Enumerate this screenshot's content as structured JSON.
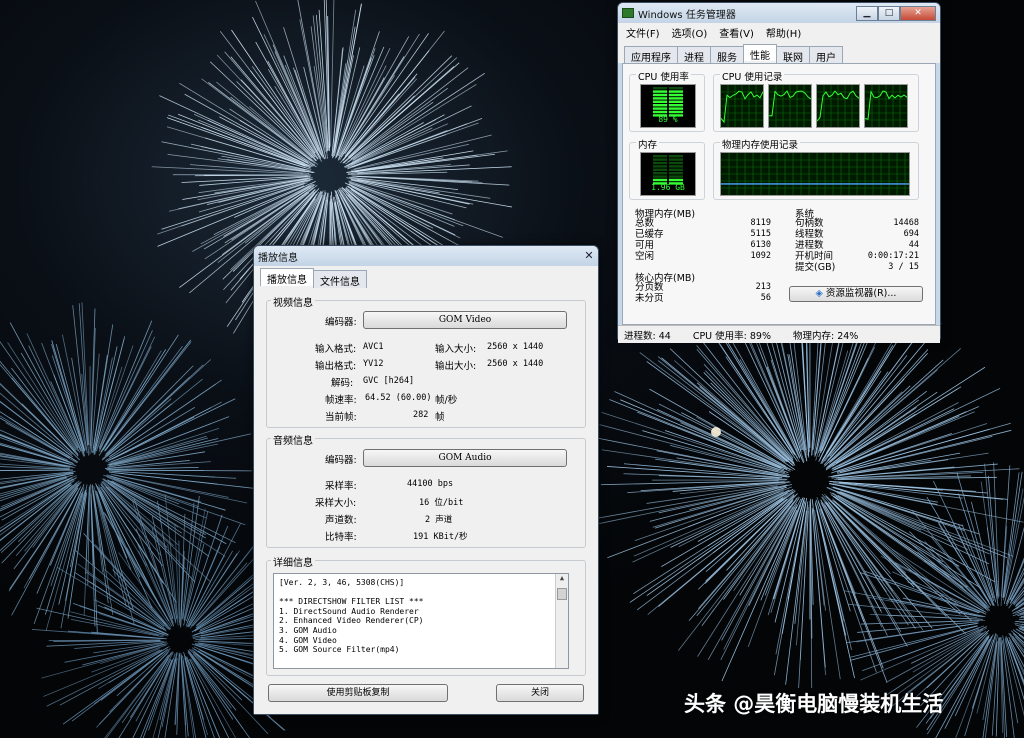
{
  "taskmanager": {
    "title": "Windows 任务管理器",
    "menu": [
      "文件(F)",
      "选项(O)",
      "查看(V)",
      "帮助(H)"
    ],
    "tabs": [
      "应用程序",
      "进程",
      "服务",
      "性能",
      "联网",
      "用户"
    ],
    "active_tab": "性能",
    "cpu_usage_label": "CPU 使用率",
    "cpu_usage_value": "89 %",
    "cpu_history_label": "CPU 使用记录",
    "memory_label": "内存",
    "memory_value": "1.96 GB",
    "memory_history_label": "物理内存使用记录",
    "physical_memory": {
      "label": "物理内存(MB)",
      "rows": [
        {
          "name": "总数",
          "value": "8119"
        },
        {
          "name": "已缓存",
          "value": "5115"
        },
        {
          "name": "可用",
          "value": "6130"
        },
        {
          "name": "空闲",
          "value": "1092"
        }
      ]
    },
    "system": {
      "label": "系统",
      "rows": [
        {
          "name": "句柄数",
          "value": "14468"
        },
        {
          "name": "线程数",
          "value": "694"
        },
        {
          "name": "进程数",
          "value": "44"
        },
        {
          "name": "开机时间",
          "value": "0:00:17:21"
        },
        {
          "name": "提交(GB)",
          "value": "3 / 15"
        }
      ]
    },
    "kernel_memory": {
      "label": "核心内存(MB)",
      "rows": [
        {
          "name": "分页数",
          "value": "213"
        },
        {
          "name": "未分页",
          "value": "56"
        }
      ]
    },
    "resource_monitor_button": "资源监视器(R)...",
    "status": {
      "processes": "进程数: 44",
      "cpu": "CPU 使用率: 89%",
      "memory": "物理内存: 24%"
    },
    "cpu_level": 0.89,
    "memory_level": 0.24
  },
  "playback": {
    "title": "播放信息",
    "tabs": [
      "播放信息",
      "文件信息"
    ],
    "active_tab": "播放信息",
    "video": {
      "section": "视频信息",
      "codec_label": "编码器:",
      "codec_button": "GOM Video",
      "input_format_label": "输入格式:",
      "input_format": "AVC1",
      "input_size_label": "输入大小:",
      "input_size": "2560 x 1440",
      "output_format_label": "输出格式:",
      "output_format": "YV12",
      "output_size_label": "输出大小:",
      "output_size": "2560 x 1440",
      "decode_label": "解码:",
      "decode": "GVC [h264]",
      "framerate_label": "帧速率:",
      "framerate": "64.52 (60.00)",
      "framerate_unit": "帧/秒",
      "current_frame_label": "当前帧:",
      "current_frame": "282",
      "current_frame_unit": "帧"
    },
    "audio": {
      "section": "音频信息",
      "codec_label": "编码器:",
      "codec_button": "GOM Audio",
      "sample_rate_label": "采样率:",
      "sample_rate": "44100 bps",
      "sample_size_label": "采样大小:",
      "sample_size": "16 位/bit",
      "channels_label": "声道数:",
      "channels": "2 声道",
      "bitrate_label": "比特率:",
      "bitrate": "191 KBit/秒"
    },
    "details": {
      "section": "详细信息",
      "lines": [
        "[Ver. 2, 3, 46, 5308(CHS)]",
        "",
        "*** DIRECTSHOW FILTER LIST ***",
        "1. DirectSound Audio Renderer",
        "2. Enhanced Video Renderer(CP)",
        "3. GOM Audio",
        "4. GOM Video",
        "5. GOM Source Filter(mp4)"
      ]
    },
    "copy_button": "使用剪贴板复制",
    "close_button": "关闭"
  },
  "watermark": "头条 @昊衡电脑慢装机生活"
}
